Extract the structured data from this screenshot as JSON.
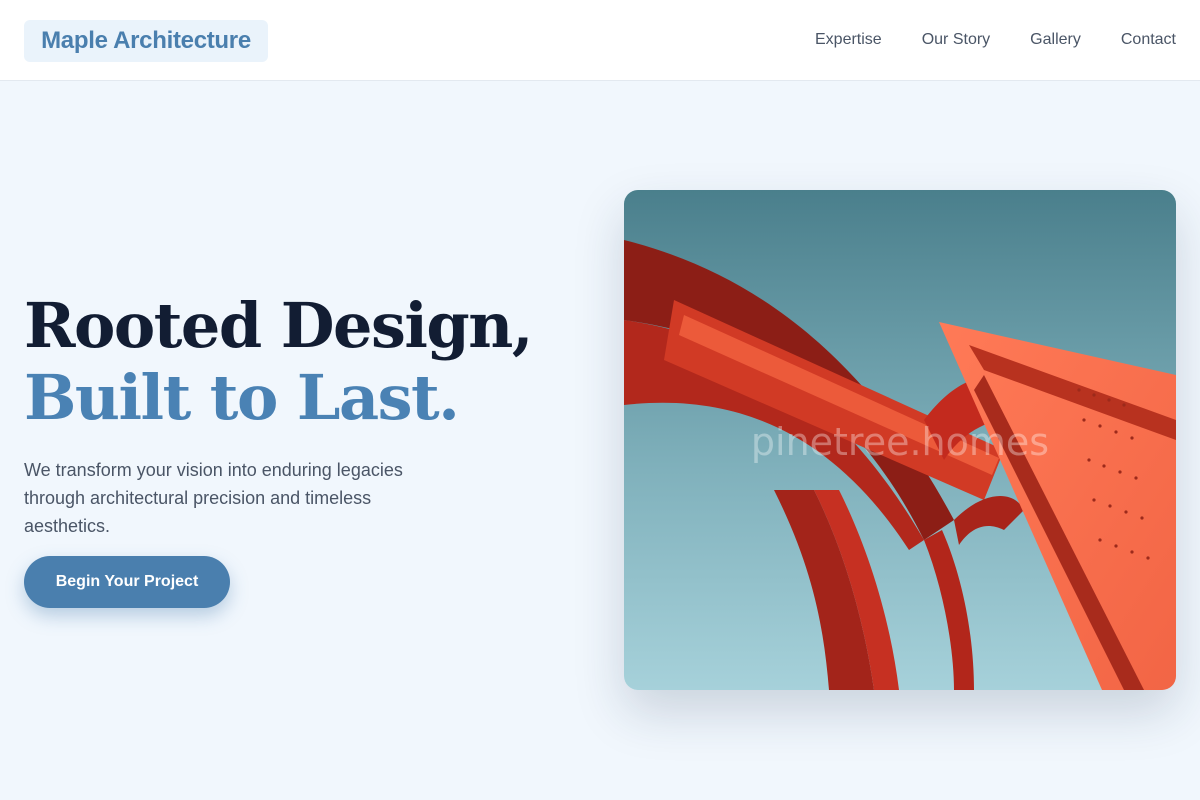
{
  "header": {
    "brand": "Maple Architecture",
    "nav": [
      "Expertise",
      "Our Story",
      "Gallery",
      "Contact"
    ]
  },
  "hero": {
    "title_line1": "Rooted Design,",
    "title_line2": "Built to Last.",
    "description": "We transform your vision into enduring legacies through architectural precision and timeless aesthetics.",
    "cta_label": "Begin Your Project"
  },
  "image": {
    "subject": "red-steel-sculpture-photo",
    "watermark": "pinetree.homes"
  },
  "colors": {
    "accent": "#4a7fae",
    "heading": "#121d33",
    "background": "#f1f7fd"
  }
}
